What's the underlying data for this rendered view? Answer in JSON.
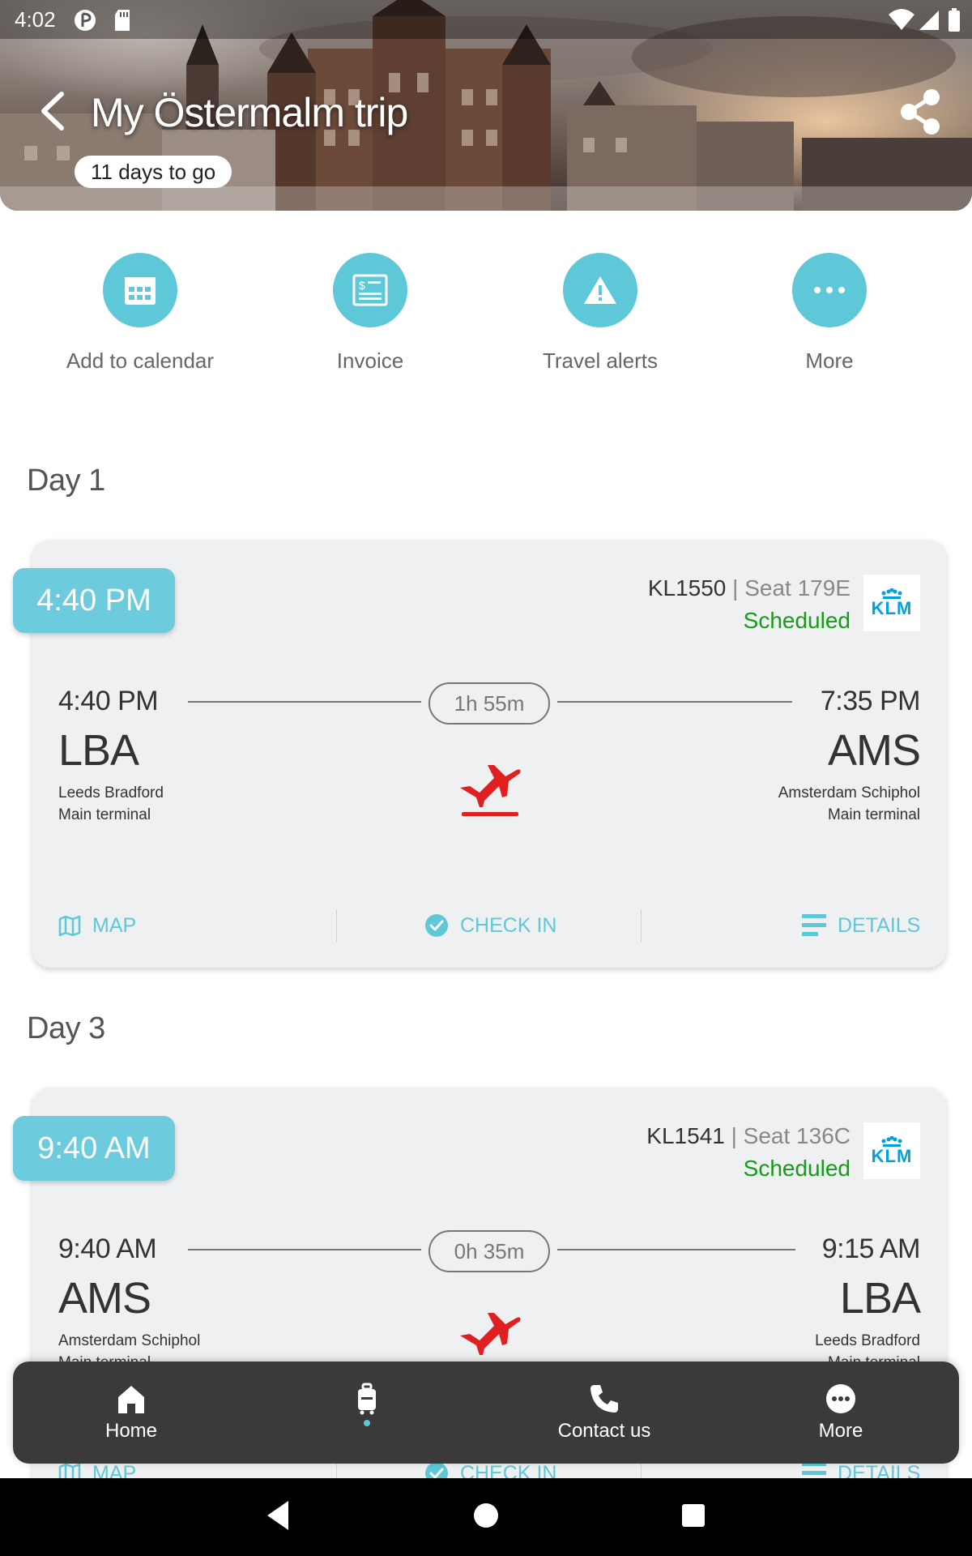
{
  "status_bar": {
    "time": "4:02"
  },
  "header": {
    "title": "My Östermalm trip",
    "countdown": "11 days to go"
  },
  "actions": [
    {
      "label": "Add to calendar",
      "icon": "calendar-icon"
    },
    {
      "label": "Invoice",
      "icon": "invoice-icon"
    },
    {
      "label": "Travel alerts",
      "icon": "warning-icon"
    },
    {
      "label": "More",
      "icon": "more-dots-icon"
    }
  ],
  "days": [
    {
      "heading": "Day 1",
      "flight": {
        "time_tag": "4:40 PM",
        "flight_number": "KL1550",
        "seat": "| Seat 179E",
        "status": "Scheduled",
        "airline": "KLM",
        "departure": {
          "time": "4:40 PM",
          "code": "LBA",
          "airport": "Leeds Bradford",
          "terminal": "Main terminal"
        },
        "arrival": {
          "time": "7:35 PM",
          "code": "AMS",
          "airport": "Amsterdam Schiphol",
          "terminal": "Main terminal"
        },
        "duration": "1h 55m",
        "actions": {
          "map": "MAP",
          "check_in": "CHECK IN",
          "details": "DETAILS"
        }
      }
    },
    {
      "heading": "Day 3",
      "flight": {
        "time_tag": "9:40 AM",
        "flight_number": "KL1541",
        "seat": "| Seat 136C",
        "status": "Scheduled",
        "airline": "KLM",
        "departure": {
          "time": "9:40 AM",
          "code": "AMS",
          "airport": "Amsterdam Schiphol",
          "terminal": "Main terminal"
        },
        "arrival": {
          "time": "9:15 AM",
          "code": "LBA",
          "airport": "Leeds Bradford",
          "terminal": "Main terminal"
        },
        "duration": "0h 35m",
        "actions": {
          "map": "MAP",
          "check_in": "CHECK IN",
          "details": "DETAILS"
        }
      }
    }
  ],
  "bottom_nav": [
    {
      "label": "Home",
      "icon": "home-icon"
    },
    {
      "label": "",
      "icon": "luggage-icon",
      "active": true
    },
    {
      "label": "Contact us",
      "icon": "phone-icon"
    },
    {
      "label": "More",
      "icon": "more-dots-icon"
    }
  ],
  "colors": {
    "accent": "#5fc8d8",
    "status_scheduled": "#1a9a1a",
    "plane": "#e02020",
    "nav_bg": "#3a3a3a"
  }
}
